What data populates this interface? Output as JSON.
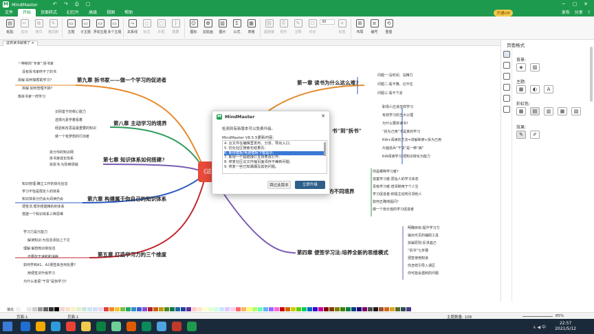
{
  "titlebar": {
    "app_title": "MindMaster",
    "quick_access": "↶ ↷ ⎙ ▢"
  },
  "menu": {
    "items": [
      "文件",
      "开始",
      "页面样式",
      "幻灯片",
      "高级",
      "视图",
      "帮助"
    ],
    "vip": "开通VIP",
    "right": [
      "发布",
      "分享",
      "?"
    ]
  },
  "ribbon": {
    "buttons": [
      {
        "label": "粘贴",
        "icon": "▤",
        "dim": false
      },
      {
        "label": "剪切",
        "icon": "✂",
        "dim": true
      },
      {
        "label": "拷贝",
        "icon": "⧉",
        "dim": true
      },
      {
        "label": "格式刷",
        "icon": "✎",
        "dim": true
      },
      {
        "label": "主题",
        "icon": "▭",
        "dim": false
      },
      {
        "label": "子主题",
        "icon": "▭",
        "dim": false
      },
      {
        "label": "浮动主题",
        "icon": "▭",
        "dim": false
      },
      {
        "label": "多个主题",
        "icon": "▭",
        "dim": false
      },
      {
        "label": "关系线",
        "icon": "⤳",
        "dim": false
      },
      {
        "label": "标注",
        "icon": "◻",
        "dim": true
      },
      {
        "label": "外框",
        "icon": "▢",
        "dim": true
      },
      {
        "label": "概要",
        "icon": "}",
        "dim": true
      },
      {
        "label": "图标",
        "icon": "☺",
        "dim": false
      },
      {
        "label": "剪贴画",
        "icon": "✿",
        "dim": false
      },
      {
        "label": "图片",
        "icon": "▨",
        "dim": false
      },
      {
        "label": "公式",
        "icon": "Σ",
        "dim": false
      },
      {
        "label": "表格",
        "icon": "▦",
        "dim": false
      },
      {
        "label": "超链接",
        "icon": "⛓",
        "dim": true
      },
      {
        "label": "附件",
        "icon": "⎘",
        "dim": true
      },
      {
        "label": "注释",
        "icon": "✎",
        "dim": true
      },
      {
        "label": "评论",
        "icon": "☐",
        "dim": true
      },
      {
        "label": "标签",
        "icon": "⌗",
        "dim": true
      },
      {
        "label": "布局",
        "icon": "⊞",
        "dim": false
      },
      {
        "label": "编号",
        "icon": "≡",
        "dim": false
      },
      {
        "label": "重置",
        "icon": "⟲",
        "dim": false
      }
    ],
    "font_size": "30"
  },
  "tab": {
    "label": "这样读书就够了"
  },
  "mindmap": {
    "center_label": "《这",
    "branches": [
      {
        "label": "第九章 拆书家——做一个学习的促进者"
      },
      {
        "label": "第八章 主动学习的境界"
      },
      {
        "label": "第七章 知识体系如何搭建?"
      },
      {
        "label": "第六章 构建属于你自己的知识体系"
      },
      {
        "label": "第五章 打造学习力的三个维度"
      },
      {
        "label": "第一章 读书为什么这么难?"
      },
      {
        "label": "书”到“拆书”"
      },
      {
        "label": "的不同境界"
      },
      {
        "label": "第四章 便签学习法:培养全新的思维模式"
      }
    ],
    "nodes": {
      "ch9": [
        "一种新的“专家”:拆书家",
        "没有拆书家终不了的书",
        "拆解:如何做帮助学习?",
        "拆解:如何管理不掉?",
        "像拆书家一样学习"
      ],
      "ch8": [
        "识别善于的核心能力",
        "选择元素学着看着",
        "经验和反思是最重要的知识",
        "做一个有梦想的行动者"
      ],
      "ch7": [
        "拆分你的知识网",
        "拆书家成长体系",
        "拆拆书:为阶梯领域"
      ],
      "ch6": [
        "知识管理:确立工作的体化信息",
        "学习不恰是限定人的体系",
        "知识体系分仍会大阅读仍会",
        "便签法:帮你搭建精的的体系",
        "搭建一个知识体系三种思维"
      ],
      "ch5": [
        "学习力是元能力",
        "解读知识:为信息添加上下文",
        "理解:解剖知识和信息",
        "不要仅于读和和消耗",
        "如何学到A1、A2便签来自何处要?",
        "用便签法升级学习",
        "为什么道语“干货”是伪学习?"
      ],
      "ch1": [
        "问题一:没时间、没精力",
        "问题二:看不懂、记不住",
        "问题三:看不下去"
      ],
      "ch2": [
        "职场人应该怎样学习",
        "有效学习的五大公理",
        "为什么要拆读书?",
        "“拆为己用”才是真的学习",
        "RIA+阅读的方法=讲解和参+拆为己用",
        "片面逃兵“干货”是一种“病”",
        "RIA阅读学习:把知识转化为能力"
      ],
      "ch3": [
        "你是哪种学习者?",
        "孩童学习者:原始人的学习状态",
        "青级学习者:增添随用于个人生",
        "学习促进者:积极主动地引领他人",
        "如何正确地提问?",
        "做一个有价值的学习促进者"
      ],
      "ch4": [
        "明确目标:提升学习力",
        "输出可见的辅助工具",
        "拆解原则:反求遍己",
        "“拆书”七步骤",
        "便签使用知道",
        "你怎样引导入误区",
        "你可能会遇到的问题"
      ]
    }
  },
  "dialog": {
    "title": "MindMaster",
    "message": "检测到有新版本可以免费升级。",
    "version": "MindMaster V8.5.5更新内容:",
    "notes": [
      "4. 云文件在编辑里发布、分享、导出入口;",
      "5. 优化社区搜索无结果页;",
      "6. 新增模板/免费模板下载提示;",
      "7. 新增一个超链接打支持表改打开;",
      "8. 修复社区云文件缩页面须存不兼新问题;",
      "9. 修复一些已知漏漏及其他问题。"
    ],
    "highlight_text": "6. 新增模板/免费模板下载提示;",
    "skip_button": "跳过此版本",
    "upgrade_button": "立即升级",
    "close": "✕"
  },
  "rightpanel": {
    "title": "页面格式",
    "bg_label": "背景:",
    "theme_label": "主题:",
    "rainbow_label": "彩虹色:",
    "effect_label": "效果:"
  },
  "palette": {
    "label": "填充",
    "colors": [
      "#f0f0f0",
      "#ffffff",
      "#e6e6e6",
      "#cccccc",
      "#999999",
      "#666666",
      "#333333",
      "#000000",
      "#f3d4d4",
      "#f8e0c8",
      "#fbf1c6",
      "#e2f0cb",
      "#cbe8d9",
      "#cde6f2",
      "#d6def3",
      "#e5d8f0",
      "#e34040",
      "#f08a24",
      "#f4c430",
      "#7cbf3a",
      "#27a567",
      "#2e8fd1",
      "#3b5fd6",
      "#8a4fd2",
      "#b2202a",
      "#c86012",
      "#c09a10",
      "#4f8a1e",
      "#13784a",
      "#1d6aa0",
      "#26409e",
      "#5c2d9a",
      "#ffcccc",
      "#ffe5cc",
      "#ffffcc",
      "#e5ffcc",
      "#ccffe5",
      "#cce5ff",
      "#d9ccff",
      "#ffccf2",
      "#ff6666",
      "#ffb266",
      "#ffff66",
      "#b2ff66",
      "#66ffb2",
      "#66b2ff",
      "#9966ff",
      "#ff66d9",
      "#cc0000",
      "#cc6600",
      "#cccc00",
      "#66cc00",
      "#00cc66",
      "#0066cc",
      "#3300cc",
      "#cc0099",
      "#800000",
      "#804000",
      "#808000",
      "#408000",
      "#008040",
      "#004080",
      "#200080",
      "#800060",
      "#4d4d4d",
      "#1a1a1a",
      "#a0522d",
      "#d2691e",
      "#daa520",
      "#556b2f",
      "#2f4f4f",
      "#483d8b"
    ]
  },
  "statusbar": {
    "page_left": "页面-1",
    "page_right": "页面-1",
    "count": "主题数量: 108",
    "zoom": "85%"
  },
  "taskbar": {
    "time": "22:57",
    "date": "2021/5/12",
    "tray": "∧ ◀ 中",
    "apps": [
      "#1f6fd0",
      "#f2a900",
      "#2d9cdb",
      "#ea4335",
      "#f2c94c",
      "#0b8043",
      "#6fcf97",
      "#e05a00",
      "#0b8a5c",
      "#4fa3e0",
      "#c0392b",
      "#1e9a4e"
    ]
  }
}
